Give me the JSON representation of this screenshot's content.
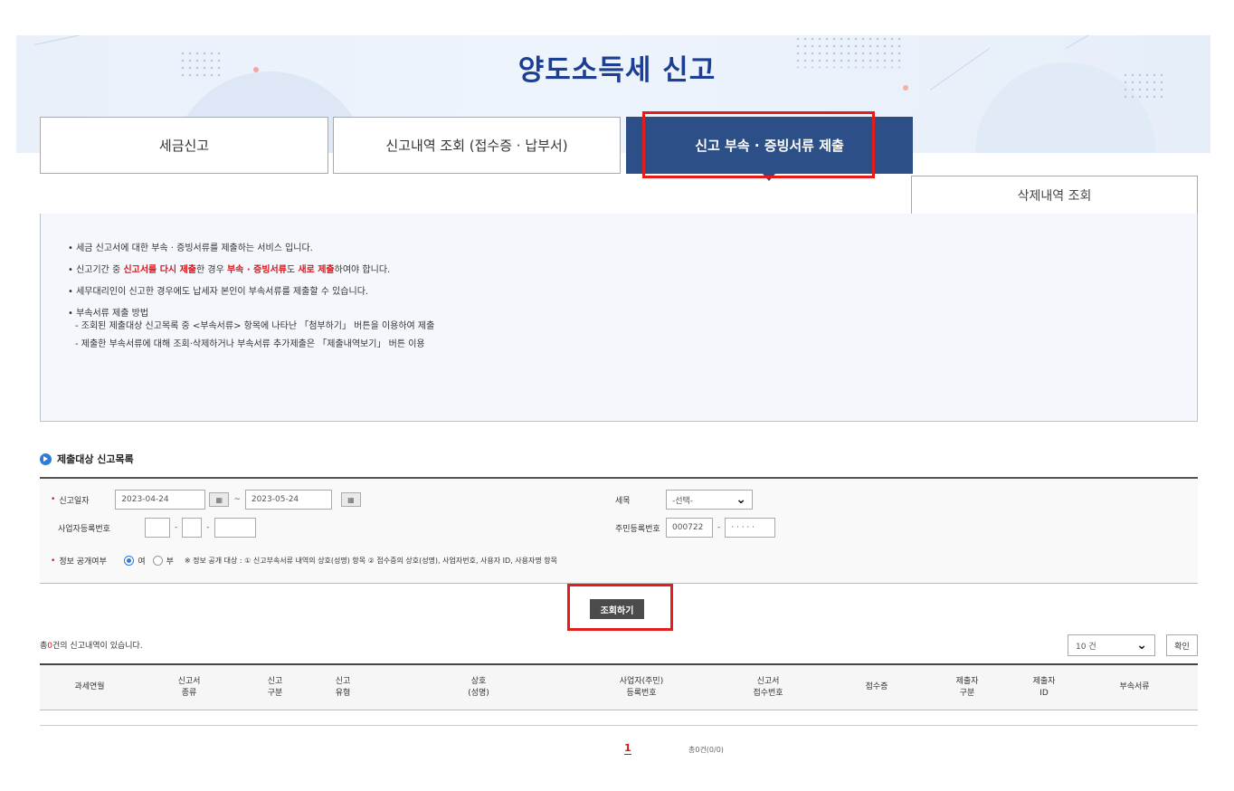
{
  "header": {
    "title": "양도소득세 신고"
  },
  "tabs": [
    {
      "label": "세금신고",
      "active": false
    },
    {
      "label": "신고내역 조회 (접수증 · 납부서)",
      "active": false
    },
    {
      "label": "신고 부속 · 증빙서류 제출",
      "active": true
    }
  ],
  "subtab": {
    "label": "삭제내역 조회"
  },
  "info": {
    "line1": "• 세금 신고서에 대한 부속 · 증빙서류를 제출하는 서비스 입니다.",
    "line2_a": "• 신고기간 중 ",
    "line2_b": "신고서를 다시 제출",
    "line2_c": "한 경우 ",
    "line2_d": "부속 · 증빙서류",
    "line2_e": "도 ",
    "line2_f": "새로 제출",
    "line2_g": "하여야 합니다.",
    "line3": "• 세무대리인이 신고한 경우에도 납세자 본인이 부속서류를 제출할 수 있습니다.",
    "line4": "• 부속서류 제출 방법",
    "line4_sub1": "- 조회된 제출대상 신고목록 중 <부속서류> 항목에 나타난 「첨부하기」 버튼을 이용하여 제출",
    "line4_sub2": "- 제출한 부속서류에 대해 조회·삭제하거나 부속서류 추가제출은 「제출내역보기」 버튼 이용"
  },
  "section": {
    "title": "제출대상 신고목록"
  },
  "search": {
    "date_label": "신고일자",
    "date_from": "2023-04-24",
    "date_to": "2023-05-24",
    "date_sep": "~",
    "cal_icon": "▦",
    "tax_label": "세목",
    "tax_value": "-선택-",
    "biz_label": "사업자등록번호",
    "dash": "-",
    "rrn_label": "주민등록번호",
    "rrn_front": "000722",
    "rrn_back": "· · · · ·",
    "public_label": "정보 공개여부",
    "opt_yes": "여",
    "opt_no": "부",
    "public_note": "※ 정보 공개 대상 : ① 신고부속서류 내역의 상호(성명) 항목 ② 접수증의 상호(성명), 사업자번호, 사용자 ID, 사용자명 항목"
  },
  "search_button": "조회하기",
  "result": {
    "count_a": "총",
    "count_n": "0",
    "count_b": "건의 신고내역이 있습니다.",
    "page_size": "10 건",
    "confirm": "확인"
  },
  "table": {
    "headers": [
      "과세연월",
      "신고서\n종류",
      "신고\n구분",
      "신고\n유형",
      "상호\n(성명)",
      "사업자(주민)\n등록번호",
      "신고서\n접수번호",
      "접수증",
      "제출자\n구분",
      "제출자\nID",
      "부속서류"
    ]
  },
  "pagination": {
    "current": "1",
    "total": "총0건(0/0)"
  },
  "colors": {
    "accent": "#2b4f86",
    "highlight": "#e31c1c",
    "radio": "#2f7bd6"
  }
}
